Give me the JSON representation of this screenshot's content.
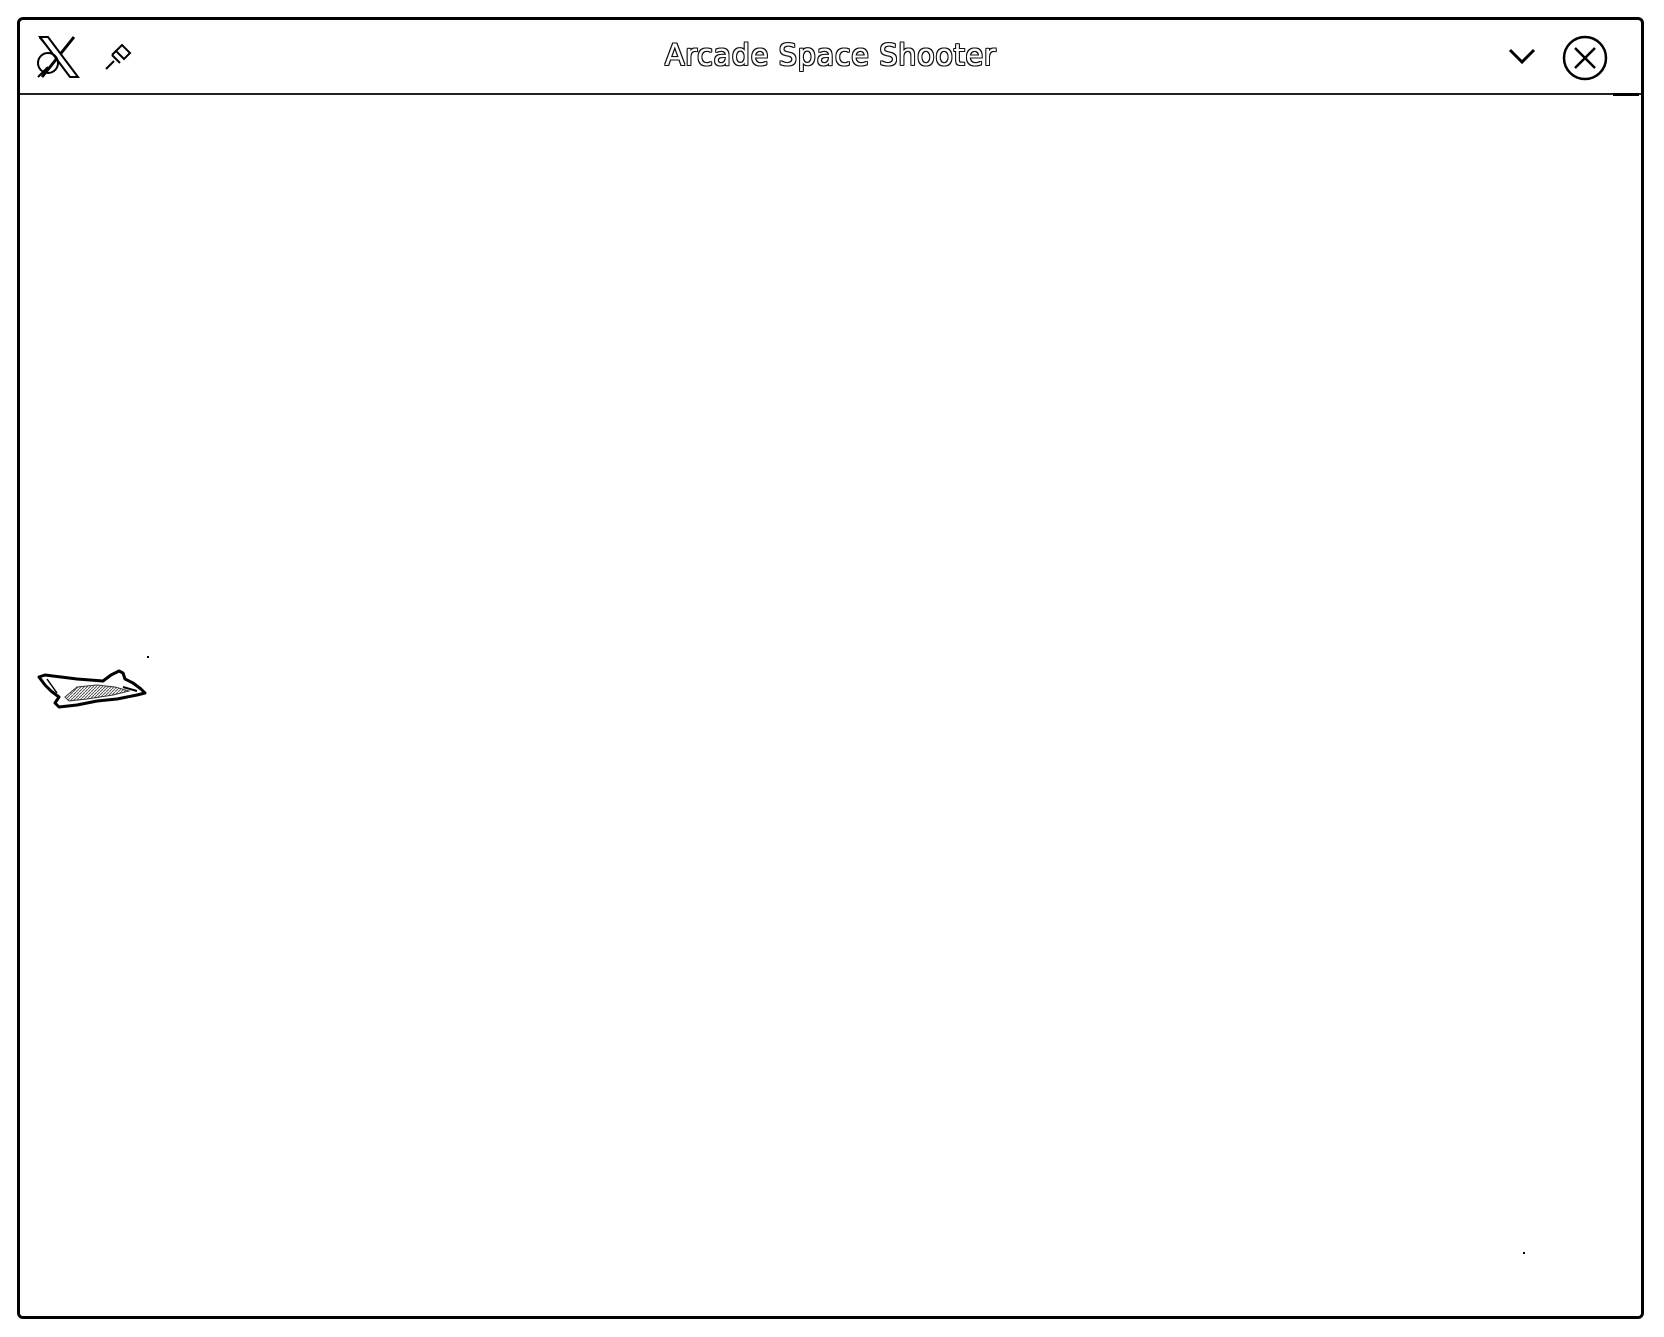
{
  "window": {
    "title": "Arcade Space Shooter"
  },
  "icons": {
    "app": "app-logo-icon",
    "pin": "pin-icon",
    "minimize": "chevron-down-icon",
    "close": "close-icon"
  },
  "game": {
    "player": "spaceship-sprite"
  },
  "colors": {
    "background": "#ffffff",
    "border": "#000000"
  }
}
